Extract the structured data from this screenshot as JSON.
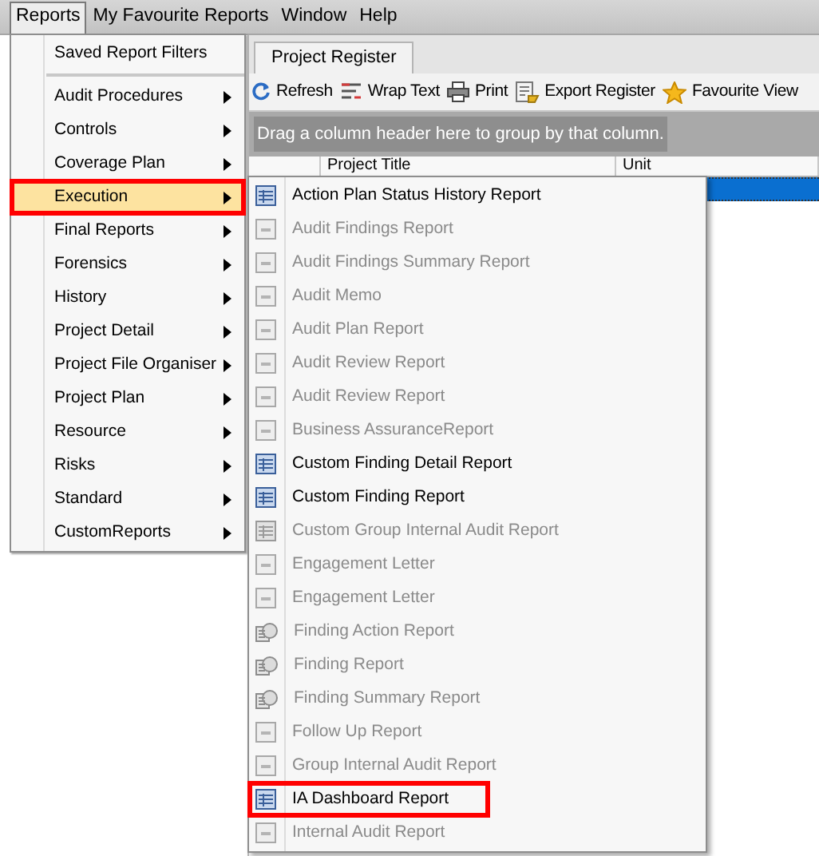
{
  "menubar": [
    {
      "label": "Reports",
      "selected": true
    },
    {
      "label": "My Favourite Reports",
      "selected": false
    },
    {
      "label": "Window",
      "selected": false
    },
    {
      "label": "Help",
      "selected": false
    }
  ],
  "tabs": [
    {
      "label": "Project Register",
      "selected": true
    }
  ],
  "toolbar": [
    {
      "label": "Refresh",
      "kind": "refresh"
    },
    {
      "label": "Wrap Text",
      "kind": "wrap"
    },
    {
      "label": "Print",
      "kind": "print"
    },
    {
      "label": "Export Register",
      "kind": "export"
    },
    {
      "label": "Favourite View",
      "kind": "star"
    }
  ],
  "group_panel": {
    "placeholder": "Drag a column header here to group by that column."
  },
  "grid": {
    "columns": [
      "Project Title",
      "Unit"
    ],
    "selected_row": true
  },
  "reports_menu": [
    {
      "kind": "command",
      "label": "Saved Report Filters",
      "selected": false,
      "annotated": false
    },
    {
      "kind": "separator"
    },
    {
      "kind": "submenu",
      "label": "Audit Procedures",
      "selected": false,
      "annotated": false
    },
    {
      "kind": "submenu",
      "label": "Controls",
      "selected": false,
      "annotated": false
    },
    {
      "kind": "submenu",
      "label": "Coverage Plan",
      "selected": false,
      "annotated": false
    },
    {
      "kind": "submenu",
      "label": "Execution",
      "selected": true,
      "annotated": true
    },
    {
      "kind": "submenu",
      "label": "Final Reports",
      "selected": false,
      "annotated": false
    },
    {
      "kind": "submenu",
      "label": "Forensics",
      "selected": false,
      "annotated": false
    },
    {
      "kind": "submenu",
      "label": "History",
      "selected": false,
      "annotated": false
    },
    {
      "kind": "submenu",
      "label": "Project Detail",
      "selected": false,
      "annotated": false
    },
    {
      "kind": "submenu",
      "label": "Project File Organiser",
      "selected": false,
      "annotated": false
    },
    {
      "kind": "submenu",
      "label": "Project Plan",
      "selected": false,
      "annotated": false
    },
    {
      "kind": "submenu",
      "label": "Resource",
      "selected": false,
      "annotated": false
    },
    {
      "kind": "submenu",
      "label": "Risks",
      "selected": false,
      "annotated": false
    },
    {
      "kind": "submenu",
      "label": "Standard",
      "selected": false,
      "annotated": false
    },
    {
      "kind": "submenu",
      "label": "CustomReports",
      "selected": false,
      "annotated": false
    }
  ],
  "execution_menu": [
    {
      "label": "Action Plan Status History Report",
      "kind": "table",
      "disabled": false,
      "annotated": false
    },
    {
      "label": "Audit Findings Report",
      "kind": "page",
      "disabled": true,
      "annotated": false
    },
    {
      "label": "Audit Findings Summary Report",
      "kind": "page",
      "disabled": true,
      "annotated": false
    },
    {
      "label": "Audit Memo",
      "kind": "page",
      "disabled": true,
      "annotated": false
    },
    {
      "label": "Audit Plan Report",
      "kind": "page",
      "disabled": true,
      "annotated": false
    },
    {
      "label": "Audit Review Report",
      "kind": "page",
      "disabled": true,
      "annotated": false
    },
    {
      "label": "Audit Review Report",
      "kind": "page",
      "disabled": true,
      "annotated": false
    },
    {
      "label": "Business AssuranceReport",
      "kind": "page",
      "disabled": true,
      "annotated": false
    },
    {
      "label": "Custom Finding Detail Report",
      "kind": "table",
      "disabled": false,
      "annotated": false
    },
    {
      "label": "Custom Finding Report",
      "kind": "table",
      "disabled": false,
      "annotated": false
    },
    {
      "label": "Custom Group Internal Audit Report",
      "kind": "table",
      "disabled": true,
      "annotated": false
    },
    {
      "label": "Engagement Letter",
      "kind": "page",
      "disabled": true,
      "annotated": false
    },
    {
      "label": "Engagement Letter",
      "kind": "page",
      "disabled": true,
      "annotated": false
    },
    {
      "label": "Finding Action Report",
      "kind": "stack",
      "disabled": true,
      "annotated": false
    },
    {
      "label": "Finding Report",
      "kind": "stack",
      "disabled": true,
      "annotated": false
    },
    {
      "label": "Finding Summary Report",
      "kind": "stack",
      "disabled": true,
      "annotated": false
    },
    {
      "label": "Follow Up Report",
      "kind": "page",
      "disabled": true,
      "annotated": false
    },
    {
      "label": "Group Internal Audit Report",
      "kind": "page",
      "disabled": true,
      "annotated": false
    },
    {
      "label": "IA Dashboard Report",
      "kind": "table",
      "disabled": false,
      "annotated": true
    },
    {
      "label": "Internal Audit Report",
      "kind": "page",
      "disabled": true,
      "annotated": false
    }
  ]
}
